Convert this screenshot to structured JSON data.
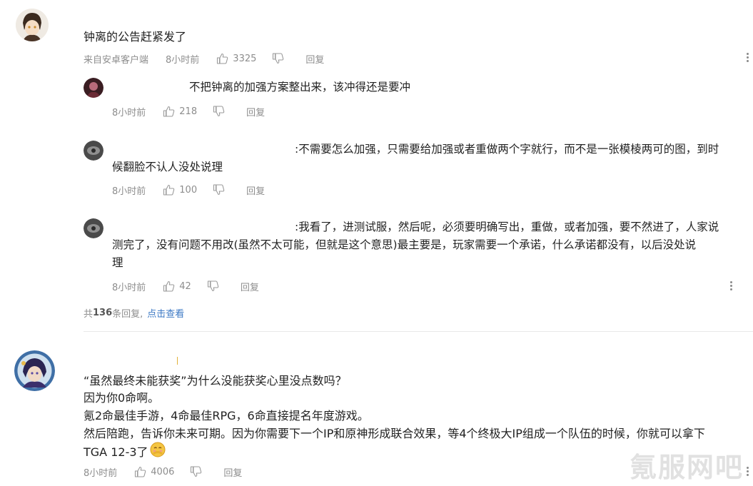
{
  "thread1": {
    "comment_text": "钟离的公告赶紧发了",
    "source": "来自安卓客户端",
    "time": "8小时前",
    "likes": "3325",
    "reply_label": "回复",
    "replies": [
      {
        "text": "不把钟离的加强方案整出来，该冲得还是要冲",
        "time": "8小时前",
        "likes": "218",
        "reply_label": "回复"
      },
      {
        "text_line1": ":不需要怎么加强，只需要给加强或者重做两个字就行，而不是一张模棱两可的图，到时",
        "text_line2": "候翻脸不认人没处说理",
        "time": "8小时前",
        "likes": "100",
        "reply_label": "回复"
      },
      {
        "text_line1": ":我看了，进测试服，然后呢，必须要明确写出，重做，或者加强，要不然进了，人家说",
        "text_line2": "测完了，没有问题不用改(虽然不太可能，但就是这个意思)最主要是，玩家需要一个承诺，什么承诺都没有，以后没处说",
        "text_line3": "理",
        "time": "8小时前",
        "likes": "42",
        "reply_label": "回复"
      }
    ],
    "total_prefix": "共",
    "total_count": "136",
    "total_suffix": "条回复,",
    "view_link": "点击查看"
  },
  "thread2": {
    "line1": "“虽然最终未能获奖”为什么没能获奖心里没点数吗？",
    "line2": "因为你0命啊。",
    "line3": "氪2命最佳手游，4命最佳RPG，6命直接提名年度游戏。",
    "line4": "然后陪跑，告诉你未来可期。因为你需要下一个IP和原神形成联合效果，等4个终极大IP组成一个队伍的时候，你就可以拿下",
    "line5": "TGA 12-3了",
    "time": "8小时前",
    "likes": "4006",
    "reply_label": "回复"
  },
  "watermark": "氪服网吧",
  "colors": {
    "link": "#3b78c4",
    "meta": "#8d8d8d",
    "text": "#222222"
  }
}
